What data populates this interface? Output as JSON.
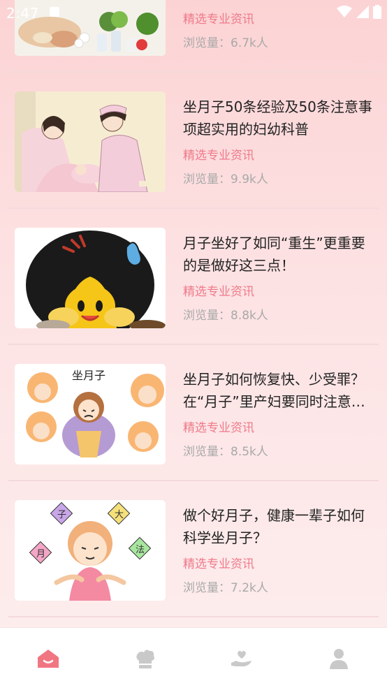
{
  "status": {
    "time": "2:47"
  },
  "colors": {
    "accent": "#ee7a8a",
    "icon_inactive": "#c9c9c9",
    "icon_active": "#f07782"
  },
  "articles": [
    {
      "title": "",
      "source": "精选专业资讯",
      "views": "浏览量：6.7k人",
      "image": "food-ingredients-photo"
    },
    {
      "title": "坐月子50条经验及50条注意事项超实用的妇幼科普",
      "source": "精选专业资讯",
      "views": "浏览量：9.9k人",
      "image": "nurse-and-mother-illustration"
    },
    {
      "title": "月子坐好了如同“重生”更重要的是做好这三点！",
      "source": "精选专业资讯",
      "views": "浏览量：8.8k人",
      "image": "emoji-face-cartoon"
    },
    {
      "title": "坐月子如何恢复快、少受罪？在“月子”里产妇要同时注意这些",
      "source": "精选专业资讯",
      "views": "浏览量：8.5k人",
      "image": "zuo-yuezi-cartoon"
    },
    {
      "title": "做个好月子，健康一辈子如何科学坐月子？",
      "source": "精选专业资讯",
      "views": "浏览量：7.2k人",
      "image": "meditating-girl-cartoon"
    }
  ],
  "thumb_text": {
    "zuoyuezi": "坐月子",
    "zuo": "子",
    "da": "大",
    "yue": "月",
    "fa": "法"
  },
  "tabs": [
    {
      "name": "home",
      "icon": "home-icon",
      "active": true
    },
    {
      "name": "chef",
      "icon": "chef-hat-icon",
      "active": false
    },
    {
      "name": "care",
      "icon": "hand-heart-icon",
      "active": false
    },
    {
      "name": "profile",
      "icon": "person-icon",
      "active": false
    }
  ]
}
